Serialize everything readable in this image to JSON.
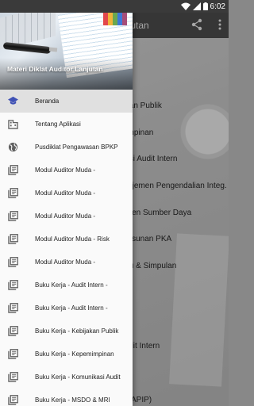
{
  "status_bar": {
    "time": "6:02"
  },
  "app": {
    "title_partial": "njutan",
    "background_items": [
      "jakan Publik",
      "mimpinan",
      "ikasi Audit Intern",
      "anajemen Pengendalian Integ.",
      "jemen Sumber Daya",
      "nyusunan PKA",
      "eviu & Simpulan",
      "Audit Intern",
      "or (APIP)"
    ]
  },
  "drawer": {
    "header_title": "Materi Diklat Auditor Lanjutan",
    "items": [
      {
        "label": "Beranda",
        "icon": "school-icon",
        "active": true
      },
      {
        "label": "Tentang Aplikasi",
        "icon": "business-icon",
        "active": false
      },
      {
        "label": "Pusdiklat Pengawasan BPKP",
        "icon": "globe-icon",
        "active": false
      },
      {
        "label": "Modul Auditor Muda -",
        "icon": "library-books-icon",
        "active": false
      },
      {
        "label": "Modul Auditor Muda -",
        "icon": "library-books-icon",
        "active": false
      },
      {
        "label": "Modul Auditor Muda -",
        "icon": "library-books-icon",
        "active": false
      },
      {
        "label": "Modul Auditor Muda - Risk",
        "icon": "library-books-icon",
        "active": false
      },
      {
        "label": "Modul Auditor Muda -",
        "icon": "library-books-icon",
        "active": false
      },
      {
        "label": "Buku Kerja - Audit Intern -",
        "icon": "library-books-icon",
        "active": false
      },
      {
        "label": "Buku Kerja - Audit Intern -",
        "icon": "library-books-icon",
        "active": false
      },
      {
        "label": "Buku Kerja - Kebijakan Publik",
        "icon": "library-books-icon",
        "active": false
      },
      {
        "label": "Buku Kerja - Kepemimpinan",
        "icon": "library-books-icon",
        "active": false
      },
      {
        "label": "Buku Kerja - Komunikasi Audit",
        "icon": "library-books-icon",
        "active": false
      },
      {
        "label": "Buku Kerja - MSDO & MRI",
        "icon": "library-books-icon",
        "active": false
      }
    ]
  },
  "colors": {
    "accent": "#3f51b5",
    "drawer_bg": "#fafafa",
    "active_bg": "#e0e0e0",
    "icon_gray": "#616161"
  }
}
